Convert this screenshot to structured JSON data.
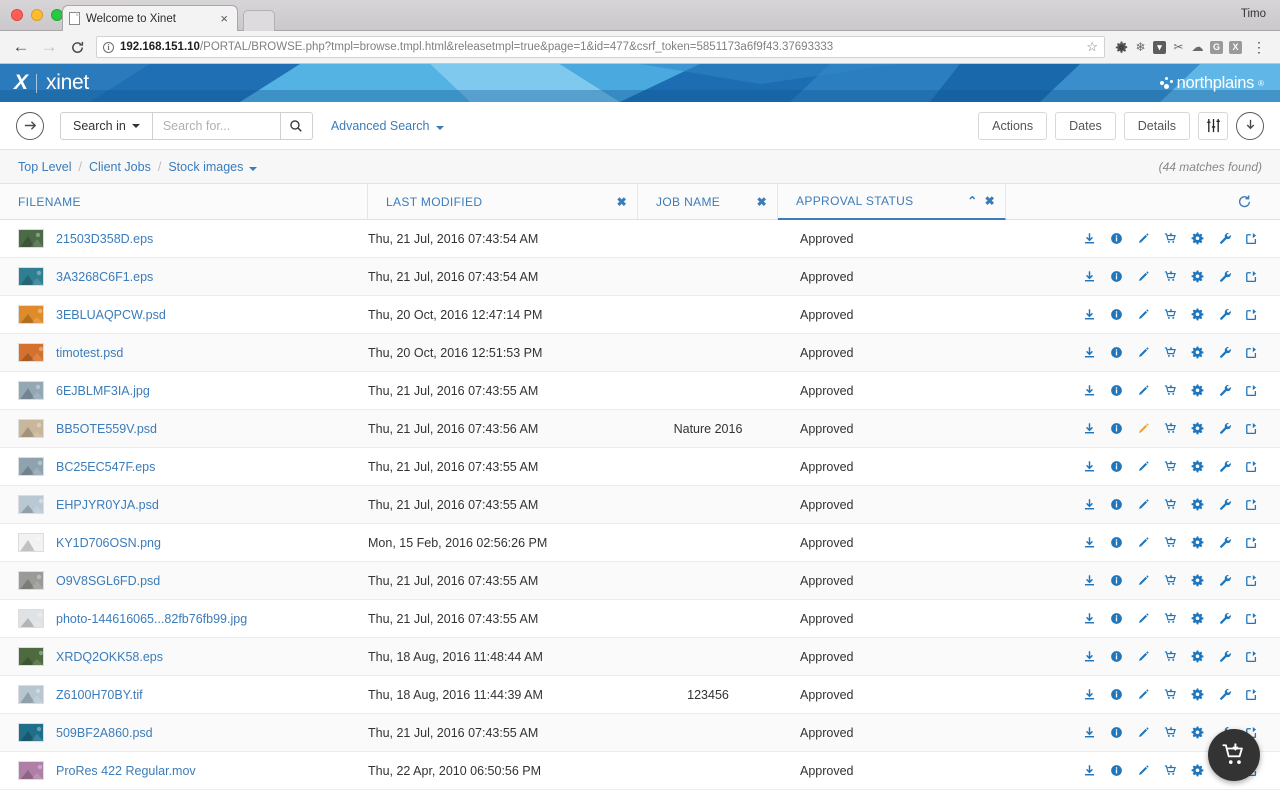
{
  "browser": {
    "user_label": "Timo",
    "tab_title": "Welcome to Xinet",
    "tab_close": "×",
    "url_host": "192.168.151.10",
    "url_path": "/PORTAL/BROWSE.php?tmpl=browse.tmpl.html&releasetmpl=true&page=1&id=477&csrf_token=5851173a6f9f43.37693333",
    "back_glyph": "←",
    "forward_glyph": "→",
    "reload_glyph": "C",
    "star_glyph": "☆",
    "menu_glyph": "⋮",
    "extensions": [
      "gear-icon",
      "snowflake-icon",
      "pocket-icon",
      "scissors-icon",
      "cloud-icon",
      "G",
      "X"
    ]
  },
  "brand": {
    "product": "xinet",
    "mark": "X",
    "company": "northplains",
    "trademark": "®",
    "bg_color": "#1b6cb0"
  },
  "search": {
    "go_arrow_label": "submit-arrow",
    "scope_label": "Search in",
    "placeholder": "Search for...",
    "value": "",
    "search_icon": "search-icon",
    "advanced_label": "Advanced Search"
  },
  "toolbar": {
    "actions_label": "Actions",
    "dates_label": "Dates",
    "details_label": "Details",
    "filters_icon": "sliders-icon",
    "download_icon": "download-circle-icon"
  },
  "breadcrumb": {
    "items": [
      "Top Level",
      "Client Jobs",
      "Stock images"
    ],
    "separator": "/",
    "matches": "(44 matches found)"
  },
  "table": {
    "columns": [
      {
        "label": "FILENAME",
        "controls": []
      },
      {
        "label": "LAST MODIFIED",
        "controls": [
          "✖"
        ]
      },
      {
        "label": "JOB NAME",
        "controls": [
          "✖"
        ]
      },
      {
        "label": "APPROVAL STATUS",
        "controls": [
          "⌃",
          "✖"
        ],
        "sorted": true
      }
    ],
    "refresh_icon": "refresh-icon",
    "row_actions": [
      "download-icon",
      "info-icon",
      "edit-pencil-icon",
      "cart-icon",
      "gear-icon",
      "wrench-icon",
      "share-icon"
    ],
    "rows": [
      {
        "filename": "21503D358D.eps",
        "modified": "Thu, 21 Jul, 2016 07:43:54 AM",
        "job": "",
        "approval": "Approved",
        "thumb": "#4b6b46",
        "edit_highlight": false
      },
      {
        "filename": "3A3268C6F1.eps",
        "modified": "Thu, 21 Jul, 2016 07:43:54 AM",
        "job": "",
        "approval": "Approved",
        "thumb": "#2f7f92",
        "edit_highlight": false
      },
      {
        "filename": "3EBLUAQPCW.psd",
        "modified": "Thu, 20 Oct, 2016 12:47:14 PM",
        "job": "",
        "approval": "Approved",
        "thumb": "#e08b2a",
        "edit_highlight": false
      },
      {
        "filename": "timotest.psd",
        "modified": "Thu, 20 Oct, 2016 12:51:53 PM",
        "job": "",
        "approval": "Approved",
        "thumb": "#d4712c",
        "edit_highlight": false
      },
      {
        "filename": "6EJBLMF3IA.jpg",
        "modified": "Thu, 21 Jul, 2016 07:43:55 AM",
        "job": "",
        "approval": "Approved",
        "thumb": "#93a7b5",
        "edit_highlight": false
      },
      {
        "filename": "BB5OTE559V.psd",
        "modified": "Thu, 21 Jul, 2016 07:43:56 AM",
        "job": "Nature 2016",
        "approval": "Approved",
        "thumb": "#c8b79a",
        "edit_highlight": true
      },
      {
        "filename": "BC25EC547F.eps",
        "modified": "Thu, 21 Jul, 2016 07:43:55 AM",
        "job": "",
        "approval": "Approved",
        "thumb": "#8ea3ad",
        "edit_highlight": false
      },
      {
        "filename": "EHPJYR0YJA.psd",
        "modified": "Thu, 21 Jul, 2016 07:43:55 AM",
        "job": "",
        "approval": "Approved",
        "thumb": "#b9c9d4",
        "edit_highlight": false
      },
      {
        "filename": "KY1D706OSN.png",
        "modified": "Mon, 15 Feb, 2016 02:56:26 PM",
        "job": "",
        "approval": "Approved",
        "thumb": "#f2f2f2",
        "edit_highlight": false
      },
      {
        "filename": "O9V8SGL6FD.psd",
        "modified": "Thu, 21 Jul, 2016 07:43:55 AM",
        "job": "",
        "approval": "Approved",
        "thumb": "#9a9a96",
        "edit_highlight": false
      },
      {
        "filename": "photo-144616065...82fb76fb99.jpg",
        "modified": "Thu, 21 Jul, 2016 07:43:55 AM",
        "job": "",
        "approval": "Approved",
        "thumb": "#dfe3e6",
        "edit_highlight": false
      },
      {
        "filename": "XRDQ2OKK58.eps",
        "modified": "Thu, 18 Aug, 2016 11:48:44 AM",
        "job": "",
        "approval": "Approved",
        "thumb": "#4d6b3f",
        "edit_highlight": false
      },
      {
        "filename": "Z6100H70BY.tif",
        "modified": "Thu, 18 Aug, 2016 11:44:39 AM",
        "job": "123456",
        "approval": "Approved",
        "thumb": "#b6c7d2",
        "edit_highlight": false
      },
      {
        "filename": "509BF2A860.psd",
        "modified": "Thu, 21 Jul, 2016 07:43:55 AM",
        "job": "",
        "approval": "Approved",
        "thumb": "#1f6f8b",
        "edit_highlight": false
      },
      {
        "filename": "ProRes 422 Regular.mov",
        "modified": "Thu, 22 Apr, 2010 06:50:56 PM",
        "job": "",
        "approval": "Approved",
        "thumb": "#b07fa8",
        "edit_highlight": false
      }
    ]
  },
  "fab": {
    "icon": "cart-download-icon",
    "bg": "#333333"
  }
}
